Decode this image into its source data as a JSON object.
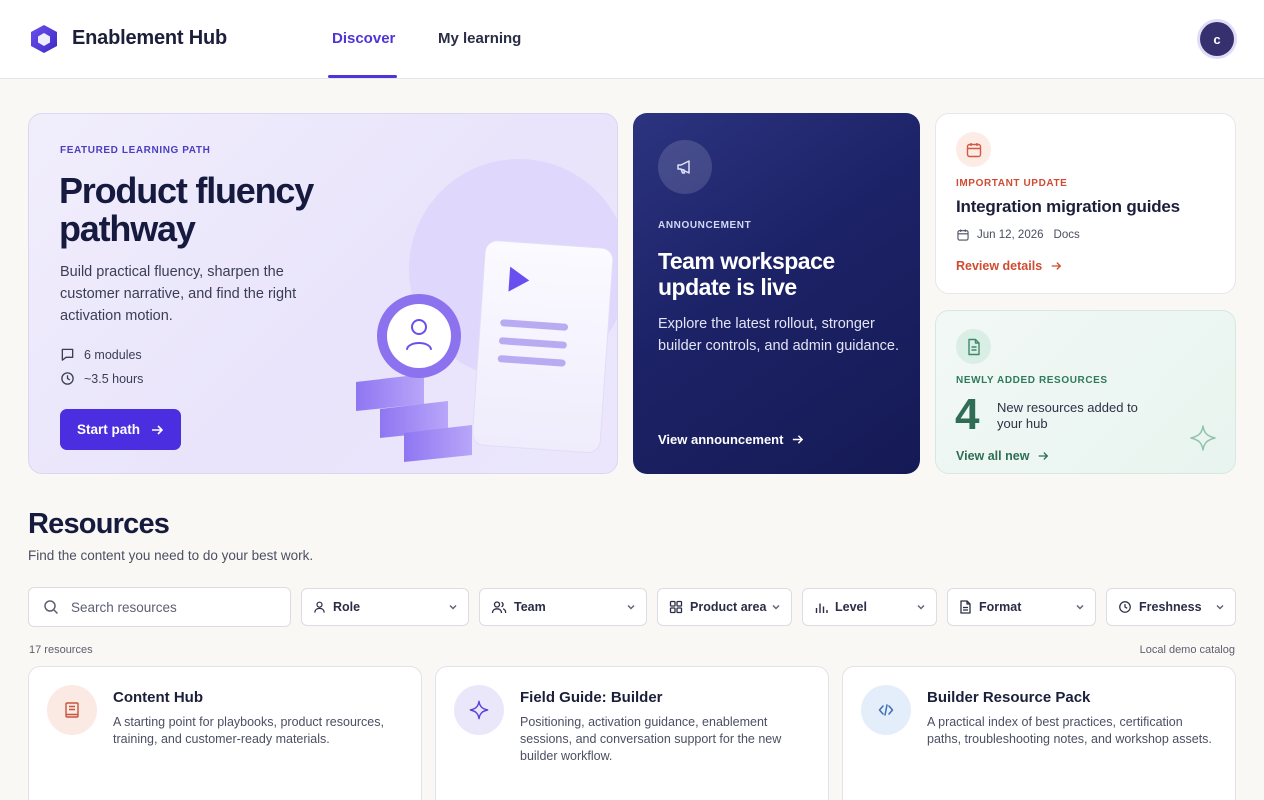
{
  "header": {
    "app_name": "Enablement Hub",
    "tabs": [
      {
        "label": "Discover",
        "active": true
      },
      {
        "label": "My learning",
        "active": false
      }
    ],
    "avatar_initial": "c"
  },
  "featured": {
    "eyebrow": "FEATURED LEARNING PATH",
    "title": "Product fluency pathway",
    "description": "Build practical fluency, sharpen the customer narrative, and find the right activation motion.",
    "modules": "6 modules",
    "duration": "~3.5 hours",
    "button_label": "Start path"
  },
  "announcement": {
    "eyebrow": "ANNOUNCEMENT",
    "title": "Team workspace update is live",
    "description": "Explore the latest rollout, stronger builder controls, and admin guidance.",
    "link_label": "View announcement"
  },
  "update": {
    "eyebrow": "IMPORTANT UPDATE",
    "title": "Integration migration guides",
    "date": "Jun 12, 2026",
    "type": "Docs",
    "link_label": "Review details"
  },
  "new_resources": {
    "eyebrow": "NEWLY ADDED RESOURCES",
    "count": "4",
    "text": "New resources added to your hub",
    "link_label": "View all new"
  },
  "resources": {
    "title": "Resources",
    "subtitle": "Find the content you need to do your best work.",
    "search_placeholder": "Search resources",
    "filters": [
      "Role",
      "Team",
      "Product area",
      "Level",
      "Format",
      "Freshness"
    ],
    "count_label": "17 resources",
    "catalog_label": "Local demo catalog",
    "cards": [
      {
        "title": "Content Hub",
        "description": "A starting point for playbooks, product resources, training, and customer-ready materials.",
        "icon": "book-icon"
      },
      {
        "title": "Field Guide: Builder",
        "description": "Positioning, activation guidance, enablement sessions, and conversation support for the new builder workflow.",
        "icon": "sparkle-icon"
      },
      {
        "title": "Builder Resource Pack",
        "description": "A practical index of best practices, certification paths, troubleshooting notes, and workshop assets.",
        "icon": "code-icon"
      }
    ]
  },
  "colors": {
    "accent": "#4f35d6",
    "navy": "#1c2266",
    "alert": "#cf4c32",
    "success": "#2f6e55",
    "background": "#faf8f4"
  }
}
